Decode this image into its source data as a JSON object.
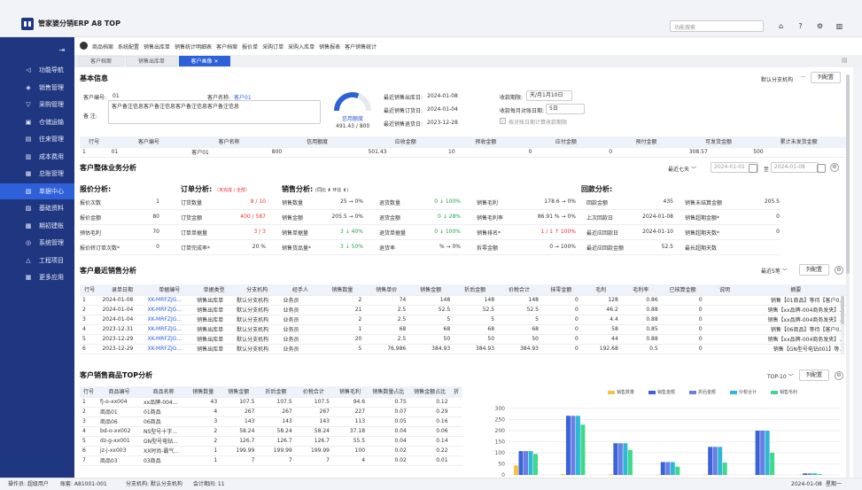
{
  "app": {
    "title": "管家婆分销ERP A8 TOP"
  },
  "header": {
    "search_placeholder": "功能搜索",
    "icons": [
      "home-icon",
      "help-icon",
      "settings-icon",
      "menu-icon"
    ]
  },
  "sidebar": {
    "items": [
      {
        "label": "功能导航",
        "icon": "send-icon"
      },
      {
        "label": "销售管理",
        "icon": "tag-icon"
      },
      {
        "label": "采购管理",
        "icon": "cart-icon"
      },
      {
        "label": "仓储运输",
        "icon": "warehouse-icon"
      },
      {
        "label": "往来管理",
        "icon": "contacts-icon"
      },
      {
        "label": "成本费用",
        "icon": "cost-icon"
      },
      {
        "label": "总账管理",
        "icon": "ledger-icon"
      },
      {
        "label": "单据中心",
        "icon": "document-icon"
      },
      {
        "label": "基础资料",
        "icon": "data-icon"
      },
      {
        "label": "期初建账",
        "icon": "opening-icon"
      },
      {
        "label": "系统管理",
        "icon": "system-icon"
      },
      {
        "label": "工程项目",
        "icon": "project-icon"
      },
      {
        "label": "更多应用",
        "icon": "apps-icon"
      }
    ],
    "active": 7
  },
  "navlinks": [
    "商品档案",
    "系统配置",
    "销售出库单",
    "销售统计明细表",
    "客户档案",
    "报价单",
    "采购订单",
    "采购入库单",
    "销售报表",
    "客户销售统计"
  ],
  "tabs": [
    {
      "label": "客户档案"
    },
    {
      "label": "销售出库单"
    },
    {
      "label": "客户画像",
      "close": "✕"
    }
  ],
  "basic": {
    "title": "基本信息",
    "btn_default_org": "默认分支机构",
    "btn_more": "···",
    "btn_columns": "列配置",
    "cust_code_label": "客户编号:",
    "cust_code": "01",
    "cust_name_label": "客户名称:",
    "cust_name": "客户01",
    "remark_label": "备    注:",
    "remark": "客户备注信息客户备注信息客户备注信息客户备注信息",
    "gauge_label": "信用额度",
    "gauge_value": "491.43 / 800",
    "gauge_fraction": 0.614,
    "last_out_label": "最近销售出库日:",
    "last_out": "2024-01-08",
    "last_order_label": "最近销售订货日:",
    "last_order": "2024-01-04",
    "last_return_label": "最近销售退货日:",
    "last_return": "2023-12-28",
    "period_label": "收款期限:",
    "period": "天/月1月10日",
    "monthly_label": "收款每月对账日期:",
    "monthly": "5日",
    "checkbox_label": "按对账日期计算收款期限"
  },
  "basic_table": {
    "headers": [
      "行号",
      "客户编号",
      "客户名称",
      "信用额度",
      "应收金额",
      "预收金额",
      "应付金额",
      "预付金额",
      "可发货金额",
      "累计未发货金额"
    ],
    "rows": [
      [
        "1",
        "01",
        "客户01",
        "800",
        "501.43",
        "10",
        "0",
        "0",
        "308.57",
        "500"
      ]
    ]
  },
  "overview": {
    "title": "客户整体业务分析",
    "range": "最近七天",
    "date_from": "2024-01-01",
    "date_sep": "至",
    "date_to": "2024-01-08",
    "quote_title": "报价分析:",
    "order_title": "订单分析:",
    "order_hint": "（未完成 / 全部）",
    "sales_title": "销售分析:",
    "sales_hint": "(同比 ⬆ 环比 ⬇)",
    "receipt_title": "回款分析:",
    "rows": [
      [
        "报价次数",
        "1",
        "订货数量",
        "8 / 10",
        "销售数量",
        "25 → 0%",
        "退货数量",
        "0 ↓ 100%",
        "销售毛利",
        "178.6 → 0%",
        "回款金额",
        "435",
        "销售未结算金额",
        "205.5"
      ],
      [
        "报价金额",
        "80",
        "订货金额",
        "400 / 587",
        "销售金额",
        "205.5 → 0%",
        "退货金额",
        "0 ↓ 28%",
        "销售毛利率",
        "86.91 % → 0%",
        "上次回款日",
        "2024-01-08",
        "销售超期金额*",
        "0"
      ],
      [
        "预估毛利",
        "70",
        "订单单据量",
        "3 / 3",
        "销售单据量",
        "3 ↓ 40%",
        "退货单据量",
        "0 ↓ 100%",
        "销售排名*",
        "1 / 1 ↑ 100%",
        "最近应回款日",
        "2024-01-10",
        "销售超期天数*",
        "0"
      ],
      [
        "报价转订单次数*",
        "0",
        "订单完成率*",
        "20 %",
        "销售货品量*",
        "3 ↓ 50%",
        "退货率",
        "% → 0%",
        "拆零金额",
        "0 → 100%",
        "最近应回款金额",
        "52.5",
        "最长超期天数",
        ""
      ]
    ]
  },
  "recent": {
    "title": "客户最近销售分析",
    "count": "最近5笔",
    "btn_columns": "列配置",
    "headers": [
      "行号",
      "录单日期",
      "单据编号",
      "单据类型",
      "分支机构",
      "经手人",
      "销售数量",
      "销售单价",
      "销售金额",
      "折后金额",
      "价税合计",
      "抹零金额",
      "毛利",
      "毛利率",
      "已核算金额",
      "说明",
      "摘要"
    ],
    "rows": [
      [
        "1",
        "2024-01-08",
        "XK-MRFZJG...",
        "销售出库单",
        "默认分支机构",
        "业务员",
        "2",
        "74",
        "148",
        "148",
        "148",
        "0",
        "128",
        "0.86",
        "0",
        "",
        "销售【01商品】等待【客户0..."
      ],
      [
        "2",
        "2024-01-04",
        "XK-MRFZJG...",
        "销售出库单",
        "默认分支机构",
        "业务员",
        "21",
        "2.5",
        "52.5",
        "52.5",
        "52.5",
        "0",
        "46.2",
        "0.88",
        "0",
        "",
        "销售【xx品牌-004商务发夹】..."
      ],
      [
        "3",
        "2024-01-04",
        "XK-MRFZJG...",
        "销售出库单",
        "默认分支机构",
        "业务员",
        "2",
        "2.5",
        "5",
        "5",
        "5",
        "0",
        "4.4",
        "0.88",
        "0",
        "",
        "销售【xx品牌-004商务发夹】..."
      ],
      [
        "4",
        "2023-12-31",
        "XK-MRFZJG...",
        "销售出库单",
        "默认分支机构",
        "业务员",
        "1",
        "68",
        "68",
        "68",
        "68",
        "0",
        "58",
        "0.85",
        "0",
        "",
        "销售【06商品】等待【客户0..."
      ],
      [
        "5",
        "2023-12-29",
        "XK-MRFZJG...",
        "销售出库单",
        "默认分支机构",
        "业务员",
        "20",
        "2.5",
        "50",
        "50",
        "50",
        "0",
        "44",
        "0.88",
        "0",
        "",
        "销售【xx品牌-004商务发夹】..."
      ],
      [
        "6",
        "2023-12-29",
        "XK-MRFZJG...",
        "销售出库单",
        "默认分支机构",
        "业务员",
        "5",
        "76.986",
        "384.93",
        "384.93",
        "384.93",
        "0",
        "192.68",
        "0.5",
        "0",
        "",
        "销售【GN型号电钻001】等..."
      ]
    ]
  },
  "top10": {
    "title": "客户销售商品TOP分析",
    "count": "TOP-10",
    "btn_columns": "列配置",
    "headers": [
      "行号",
      "商品编号",
      "商品名称",
      "销售数量",
      "销售金额",
      "折后金额",
      "价税合计",
      "销售毛利",
      "销售数量占比",
      "销售金额占比",
      "折"
    ],
    "rows": [
      [
        "1",
        "fj-o-xx004",
        "xx品牌-004...",
        "43",
        "107.5",
        "107.5",
        "107.5",
        "94.6",
        "0.75",
        "0.12",
        ""
      ],
      [
        "2",
        "商品01",
        "01商品",
        "4",
        "267",
        "267",
        "267",
        "227",
        "0.07",
        "0.29",
        ""
      ],
      [
        "3",
        "商品06",
        "06商品",
        "3",
        "143",
        "143",
        "143",
        "113",
        "0.05",
        "0.16",
        ""
      ],
      [
        "4",
        "bd-o-xx002",
        "NS型号十字...",
        "2",
        "58.24",
        "58.24",
        "58.24",
        "37.18",
        "0.04",
        "0.06",
        ""
      ],
      [
        "5",
        "dz-g-xx001",
        "GN型号电钻...",
        "2",
        "126.7",
        "126.7",
        "126.7",
        "55.5",
        "0.04",
        "0.14",
        ""
      ],
      [
        "6",
        "jz-j-xx003",
        "XX时尚-霸气...",
        "1",
        "199.99",
        "199.99",
        "199.99",
        "100",
        "0.02",
        "0.22",
        ""
      ],
      [
        "7",
        "商品03",
        "03商品",
        "1",
        "7",
        "7",
        "7",
        "4",
        "0.02",
        "0.01",
        ""
      ]
    ]
  },
  "chart_data": {
    "type": "bar",
    "series": [
      {
        "name": "销售数量",
        "color": "#f5c343",
        "values": [
          43,
          4,
          3,
          2,
          2,
          1,
          1
        ]
      },
      {
        "name": "销售金额",
        "color": "#3a63d9",
        "values": [
          107.5,
          267,
          143,
          58.24,
          126.7,
          199.99,
          7
        ]
      },
      {
        "name": "折后金额",
        "color": "#6b7ee3",
        "values": [
          107.5,
          267,
          143,
          58.24,
          126.7,
          199.99,
          7
        ]
      },
      {
        "name": "价税合计",
        "color": "#2fb8d6",
        "values": [
          107.5,
          267,
          143,
          58.24,
          126.7,
          199.99,
          7
        ]
      },
      {
        "name": "销售毛利",
        "color": "#3ed98a",
        "values": [
          94.6,
          227,
          113,
          37.18,
          55.5,
          100,
          4
        ]
      }
    ],
    "yticks": [
      0,
      50,
      100,
      150,
      200,
      250,
      300
    ],
    "ylim": [
      0,
      320
    ],
    "grid": true,
    "legend": "top"
  },
  "status": {
    "operator": "操作员: 超级用户",
    "account": "账套: A81001-001",
    "org": "分支机构: 默认分支机构",
    "period": "会计期间: 11",
    "date": "2024-01-08",
    "weekday": "星期一"
  }
}
